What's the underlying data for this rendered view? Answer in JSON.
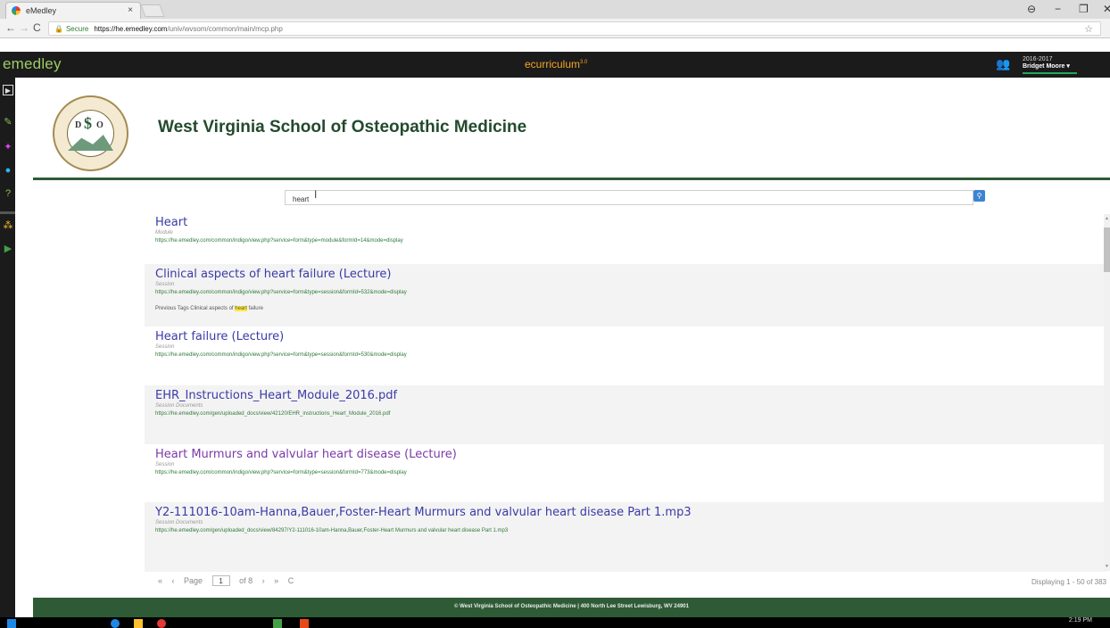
{
  "browser": {
    "tab_title": "eMedley",
    "tab_close": "×",
    "secure_label": "Secure",
    "url_host": "https://he.emedley.com",
    "url_path": "/univ/wvsom/common/main/mcp.php",
    "window_controls": [
      "⊖",
      "−",
      "❐",
      "✕"
    ]
  },
  "app": {
    "logo": "emedley",
    "product": "ecurriculum",
    "product_version": "3.0",
    "year": "2016-2017",
    "user": "Bridget Moore ▾"
  },
  "school": {
    "title": "West Virginia School of Osteopathic Medicine",
    "seal_letters": [
      "D",
      "O",
      "$"
    ]
  },
  "search": {
    "query": "heart",
    "button_icon": "search-icon"
  },
  "results": [
    {
      "title": "Heart",
      "type": "Module",
      "url": "https://he.emedley.com/common/indigo/view.php?service=form&type=module&formId=14&mode=display",
      "visited": false
    },
    {
      "title": "Clinical aspects of heart failure (Lecture)",
      "type": "Session",
      "url": "https://he.emedley.com/common/indigo/view.php?service=form&type=session&formId=532&mode=display",
      "snippet_pre": "Previous Tags Clinical aspects of ",
      "snippet_hl": "heart",
      "snippet_post": " failure",
      "visited": false
    },
    {
      "title": "Heart failure (Lecture)",
      "type": "Session",
      "url": "https://he.emedley.com/common/indigo/view.php?service=form&type=session&formId=530&mode=display",
      "visited": false
    },
    {
      "title": "EHR_Instructions_Heart_Module_2016.pdf",
      "type": "Session Documents",
      "url": "https://he.emedley.com/gen/uploaded_docs/view/42120/EHR_instructions_Heart_Module_2016.pdf",
      "visited": false
    },
    {
      "title": "Heart Murmurs and valvular heart disease (Lecture)",
      "type": "Session",
      "url": "https://he.emedley.com/common/indigo/view.php?service=form&type=session&formId=773&mode=display",
      "visited": true
    },
    {
      "title": "Y2-111016-10am-Hanna,Bauer,Foster-Heart Murmurs and valvular heart disease Part 1.mp3",
      "type": "Session Documents",
      "url": "https://he.emedley.com/gen/uploaded_docs/view/84297/Y2-111016-10am-Hanna,Bauer,Foster-Heart Murmurs and valvular heart disease Part 1.mp3",
      "visited": false
    }
  ],
  "pager": {
    "first": "«",
    "prev": "‹",
    "page_label": "Page",
    "page": "1",
    "of_label": "of 8",
    "next": "›",
    "last": "»",
    "refresh": "C",
    "displaying": "Displaying 1 - 50 of 383"
  },
  "footer": "© West Virginia School of Osteopathic Medicine | 400 North Lee Street Lewisburg, WV 24901",
  "taskbar": {
    "clock": "2:19 PM"
  },
  "colors": {
    "header_bg": "#1b1b1b",
    "brand_green": "#2f5a36",
    "link_blue": "#3a3aa8",
    "link_visited": "#7b3aa8",
    "accent_orange": "#f4a52a",
    "search_btn": "#3b84d3",
    "highlight": "#ffeb3b"
  }
}
